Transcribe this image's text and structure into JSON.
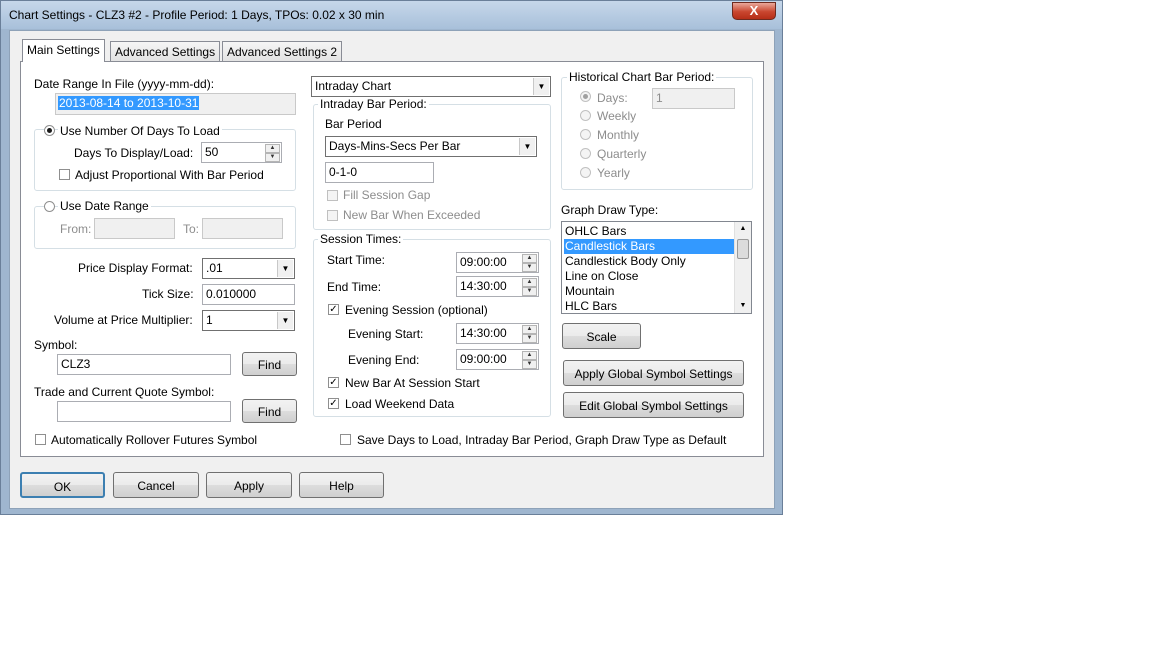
{
  "window": {
    "title": "Chart Settings - CLZ3  #2 - Profile Period: 1 Days, TPOs: 0.02 x 30 min",
    "close_label": "X"
  },
  "tabs": [
    "Main Settings",
    "Advanced Settings",
    "Advanced Settings 2"
  ],
  "date_range": {
    "label": "Date Range In File (yyyy-mm-dd):",
    "value": "2013-08-14 to 2013-10-31"
  },
  "days_group": {
    "radio_label": "Use Number Of Days To Load",
    "days_label": "Days To Display/Load:",
    "days_value": "50",
    "adjust_label": "Adjust Proportional With Bar Period"
  },
  "date_range_group": {
    "radio_label": "Use Date Range",
    "from_label": "From:",
    "to_label": "To:"
  },
  "price_display": {
    "label": "Price Display Format:",
    "value": ".01"
  },
  "tick_size": {
    "label": "Tick Size:",
    "value": "0.010000"
  },
  "vap_multiplier": {
    "label": "Volume at Price Multiplier:",
    "value": "1"
  },
  "symbol": {
    "label": "Symbol:",
    "value": "CLZ3",
    "find_label": "Find"
  },
  "trade_symbol": {
    "label": "Trade and Current Quote Symbol:",
    "value": "",
    "find_label": "Find"
  },
  "auto_rollover_label": "Automatically Rollover Futures Symbol",
  "chart_type": "Intraday Chart",
  "intraday_bar_period": {
    "group_label": "Intraday Bar Period:",
    "bar_period_label": "Bar Period",
    "bar_period_type": "Days-Mins-Secs Per Bar",
    "bar_period_value": "0-1-0",
    "fill_session_gap": "Fill Session Gap",
    "new_bar_exceeded": "New Bar When Exceeded"
  },
  "session_times": {
    "group_label": "Session Times:",
    "start_label": "Start Time:",
    "start_value": "09:00:00",
    "end_label": "End Time:",
    "end_value": "14:30:00",
    "evening_label": "Evening Session (optional)",
    "evening_start_label": "Evening Start:",
    "evening_start_value": "14:30:00",
    "evening_end_label": "Evening End:",
    "evening_end_value": "09:00:00",
    "new_bar_session_label": "New Bar At Session Start",
    "load_weekend_label": "Load Weekend Data"
  },
  "historical": {
    "group_label": "Historical Chart Bar Period:",
    "options": [
      "Days:",
      "Weekly",
      "Monthly",
      "Quarterly",
      "Yearly"
    ],
    "days_value": "1"
  },
  "graph_draw": {
    "label": "Graph Draw Type:",
    "items": [
      "OHLC Bars",
      "Candlestick Bars",
      "Candlestick Body Only",
      "Line on Close",
      "Mountain",
      "HLC Bars"
    ],
    "selected": "Candlestick Bars"
  },
  "scale_label": "Scale",
  "apply_global_label": "Apply Global Symbol Settings",
  "edit_global_label": "Edit Global Symbol Settings",
  "save_default_label": "Save Days to Load, Intraday Bar Period, Graph Draw Type as Default",
  "footer": {
    "ok": "OK",
    "cancel": "Cancel",
    "apply": "Apply",
    "help": "Help"
  },
  "colors": {
    "selection": "#3399ff",
    "window_frame": "#9fb6cf",
    "dialog_bg": "#f0f0f0"
  }
}
